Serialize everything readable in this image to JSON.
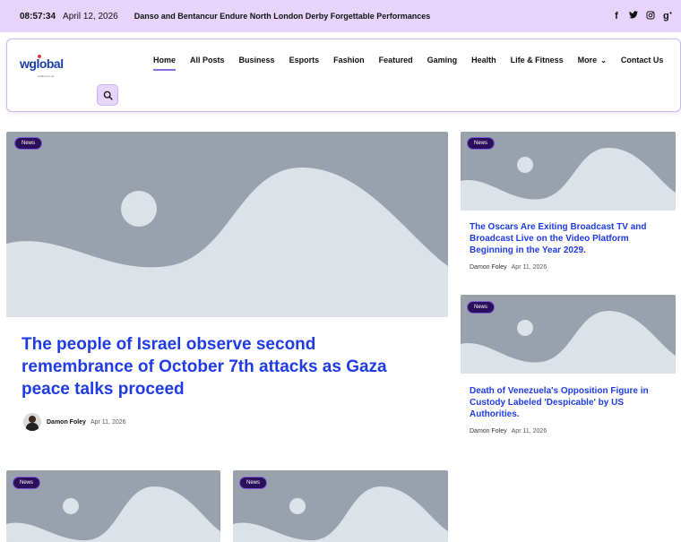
{
  "topbar": {
    "time": "08:57:34",
    "date": "April 12, 2026",
    "ticker": "Danso and Bentancur Endure North London Derby Forgettable Performances",
    "social": [
      "f",
      "t",
      "ig",
      "g+"
    ]
  },
  "logo": {
    "text": "wglobal",
    "tagline": "insiders.co.uk"
  },
  "nav": {
    "items": [
      "Home",
      "All Posts",
      "Business",
      "Esports",
      "Fashion",
      "Featured",
      "Gaming",
      "Health",
      "Life & Fitness",
      "More",
      "Contact Us"
    ],
    "active": "Home",
    "accent": "#8a6ed8"
  },
  "hero": {
    "badge": "News",
    "title": "The people of Israel observe second remembrance of October 7th attacks as Gaza peace talks proceed",
    "author": "Damon Foley",
    "date": "Apr 11, 2026"
  },
  "side": [
    {
      "badge": "News",
      "title": "The Oscars Are Exiting Broadcast TV and Broadcast Live on the Video Platform Beginning in the Year 2029.",
      "author": "Damon Foley",
      "date": "Apr 11, 2026"
    },
    {
      "badge": "News",
      "title": "Death of Venezuela's Opposition Figure in Custody Labeled 'Despicable' by US Authorities.",
      "author": "Damon Foley",
      "date": "Apr 11, 2026"
    }
  ],
  "bottom": [
    {
      "badge": "News"
    },
    {
      "badge": "News"
    }
  ],
  "colors": {
    "topbar_bg": "#e6d4fb",
    "headline": "#1f3be6",
    "badge_bg": "#2b0f5a",
    "placeholder": "#99a1ad"
  }
}
